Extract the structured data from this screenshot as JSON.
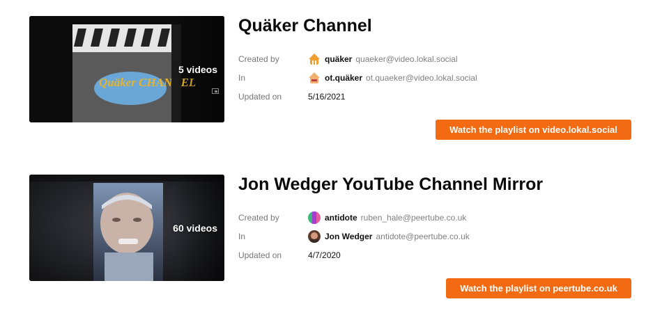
{
  "playlists": [
    {
      "title": "Quäker Channel",
      "video_count": "5 videos",
      "thumbnail_text": "Quäker CHANNEL",
      "labels": {
        "created_by": "Created by",
        "in": "In",
        "updated_on": "Updated on"
      },
      "created_by": {
        "name": "quäker",
        "handle": "quaeker@video.lokal.social",
        "avatar": "quaker-logo-avatar"
      },
      "in": {
        "name": "ot.quäker",
        "handle": "ot.quaeker@video.lokal.social",
        "avatar": "quaker-logo-avatar"
      },
      "updated_on": "5/16/2021",
      "button": "Watch the playlist on video.lokal.social"
    },
    {
      "title": "Jon Wedger YouTube Channel Mirror",
      "video_count": "60 videos",
      "labels": {
        "created_by": "Created by",
        "in": "In",
        "updated_on": "Updated on"
      },
      "created_by": {
        "name": "antidote",
        "handle": "ruben_hale@peertube.co.uk",
        "avatar": "striped-avatar"
      },
      "in": {
        "name": "Jon Wedger",
        "handle": "antidote@peertube.co.uk",
        "avatar": "portrait-avatar"
      },
      "updated_on": "4/7/2020",
      "button": "Watch the playlist on peertube.co.uk"
    }
  ],
  "colors": {
    "accent": "#f26a12",
    "label": "#777777",
    "handle": "#808080"
  }
}
